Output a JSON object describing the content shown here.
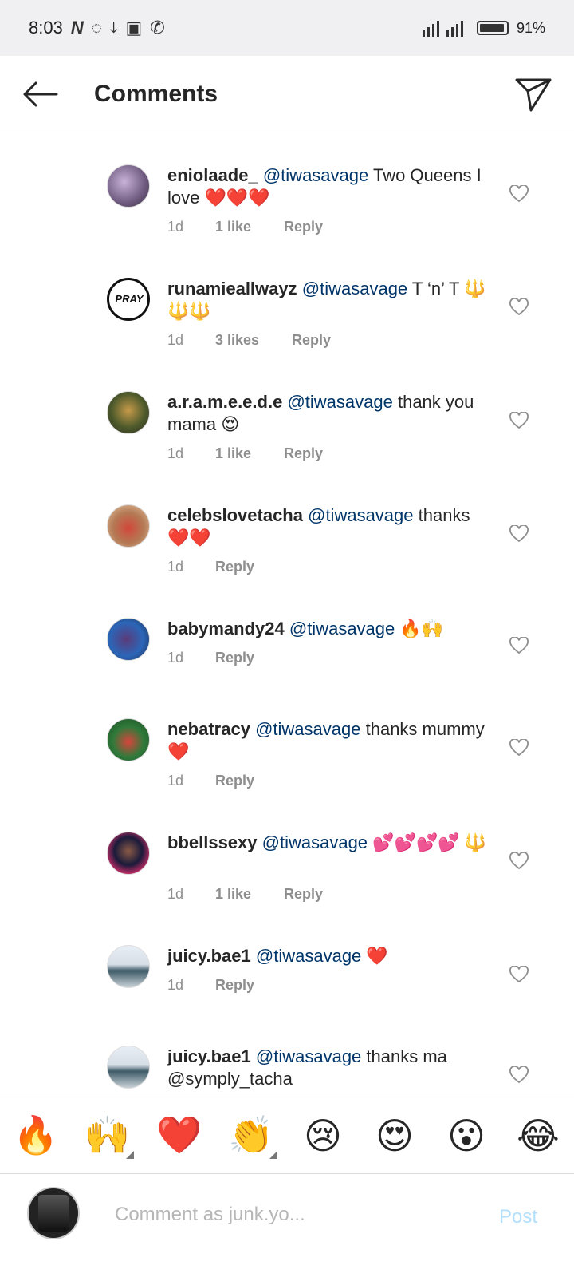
{
  "status_bar": {
    "time": "8:03",
    "battery": "91%"
  },
  "header": {
    "title": "Comments"
  },
  "comments": [
    {
      "username": "eniolaade_",
      "mention": "@tiwasavage",
      "text": "Two Queens I love",
      "emoji": "❤️❤️❤️",
      "time": "1d",
      "likes": "1 like",
      "reply": "Reply"
    },
    {
      "username": "runamieallwayz",
      "mention": "@tiwasavage",
      "text": "T ‘n’ T",
      "emoji": "🔱🔱🔱",
      "time": "1d",
      "likes": "3 likes",
      "reply": "Reply"
    },
    {
      "username": "a.r.a.m.e.e.d.e",
      "mention": "@tiwasavage",
      "text": "thank you mama",
      "emoji": "😍",
      "time": "1d",
      "likes": "1 like",
      "reply": "Reply"
    },
    {
      "username": "celebslovetacha",
      "mention": "@tiwasavage",
      "text": "thanks",
      "emoji": "❤️❤️",
      "time": "1d",
      "likes": "",
      "reply": "Reply"
    },
    {
      "username": "babymandy24",
      "mention": "@tiwasavage",
      "text": "",
      "emoji": "🔥🙌",
      "time": "1d",
      "likes": "",
      "reply": "Reply"
    },
    {
      "username": "nebatracy",
      "mention": "@tiwasavage",
      "text": "thanks mummy",
      "emoji": "❤️",
      "time": "1d",
      "likes": "",
      "reply": "Reply"
    },
    {
      "username": "bbellssexy",
      "mention": "@tiwasavage",
      "text": "",
      "emoji": "💕💕💕💕 🔱",
      "time": "1d",
      "likes": "1 like",
      "reply": "Reply"
    },
    {
      "username": "juicy.bae1",
      "mention": "@tiwasavage",
      "text": "",
      "emoji": "❤️",
      "time": "1d",
      "likes": "",
      "reply": "Reply"
    },
    {
      "username": "juicy.bae1",
      "mention": "@tiwasavage",
      "text": "thanks ma @symply_tacha",
      "emoji": "",
      "time": "",
      "likes": "",
      "reply": ""
    }
  ],
  "emoji_bar": [
    "🔥",
    "🙌",
    "❤️",
    "👏",
    "😢",
    "😍",
    "😮",
    "😂"
  ],
  "composer": {
    "placeholder": "Comment as junk.yo...",
    "post_label": "Post"
  },
  "colors": {
    "mention": "#003569",
    "muted": "#8e8e8e",
    "post": "#b2dffc"
  }
}
